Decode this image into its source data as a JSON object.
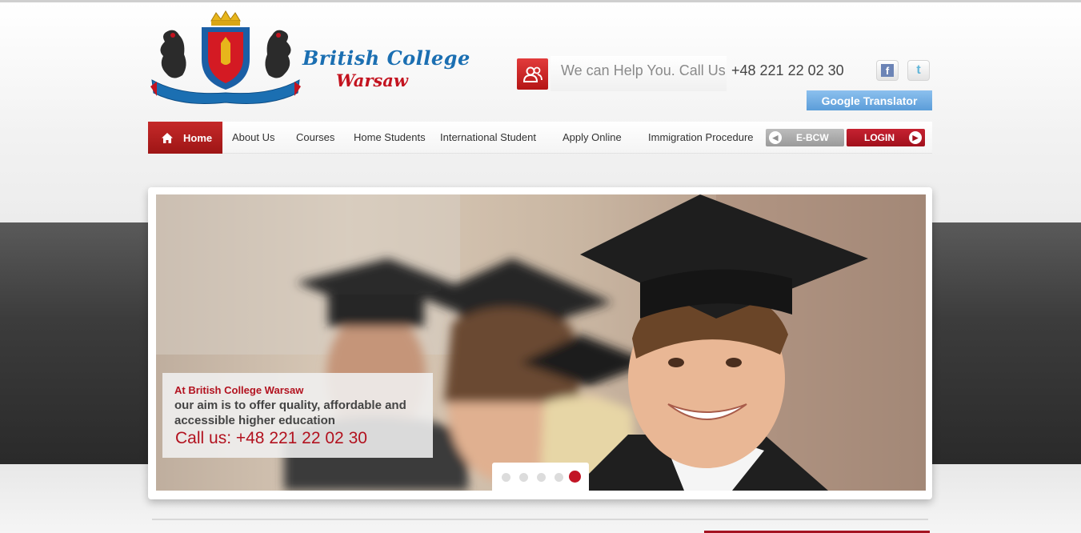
{
  "logo": {
    "line1": "British College",
    "line2": "Warsaw",
    "banner": "British College Warsaw"
  },
  "contact": {
    "help_text": "We can Help You. Call Us",
    "phone": "+48 221 22 02 30",
    "icon": "users-icon"
  },
  "social": {
    "facebook_icon": "facebook-icon",
    "twitter_icon": "twitter-icon"
  },
  "translator": {
    "label": "Google Translator"
  },
  "nav": {
    "home_label": "Home",
    "items": [
      "About Us",
      "Courses",
      "Home Students",
      "International Student",
      "Apply Online",
      "Immigration Procedure"
    ]
  },
  "buttons": {
    "ebcw": "E-BCW",
    "login": "LOGIN"
  },
  "slider": {
    "caption_title": "At British College Warsaw",
    "caption_body": "our aim is to offer quality, affordable and accessible higher education",
    "call_label": "Call us:  +48 221 22 02 30",
    "dot_count": 5,
    "active_index": 5
  },
  "colors": {
    "brand_red": "#b2121f",
    "brand_blue": "#1b6fb2",
    "translator_blue": "#5b9dd9"
  }
}
